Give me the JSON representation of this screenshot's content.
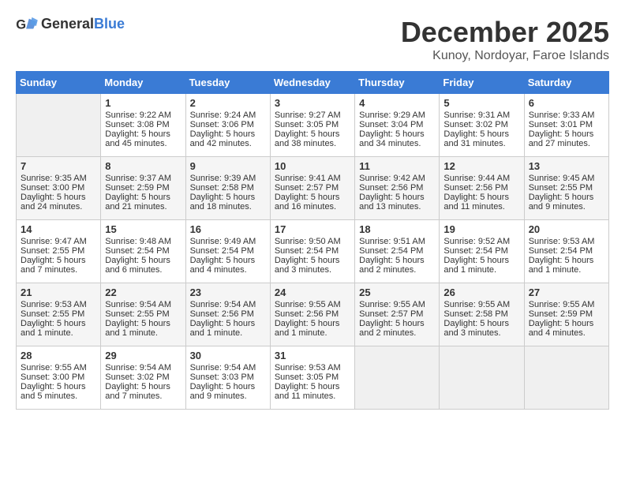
{
  "header": {
    "logo_general": "General",
    "logo_blue": "Blue",
    "month_title": "December 2025",
    "location": "Kunoy, Nordoyar, Faroe Islands"
  },
  "days_of_week": [
    "Sunday",
    "Monday",
    "Tuesday",
    "Wednesday",
    "Thursday",
    "Friday",
    "Saturday"
  ],
  "weeks": [
    [
      {
        "day": "",
        "data": ""
      },
      {
        "day": "1",
        "data": "Sunrise: 9:22 AM\nSunset: 3:08 PM\nDaylight: 5 hours\nand 45 minutes."
      },
      {
        "day": "2",
        "data": "Sunrise: 9:24 AM\nSunset: 3:06 PM\nDaylight: 5 hours\nand 42 minutes."
      },
      {
        "day": "3",
        "data": "Sunrise: 9:27 AM\nSunset: 3:05 PM\nDaylight: 5 hours\nand 38 minutes."
      },
      {
        "day": "4",
        "data": "Sunrise: 9:29 AM\nSunset: 3:04 PM\nDaylight: 5 hours\nand 34 minutes."
      },
      {
        "day": "5",
        "data": "Sunrise: 9:31 AM\nSunset: 3:02 PM\nDaylight: 5 hours\nand 31 minutes."
      },
      {
        "day": "6",
        "data": "Sunrise: 9:33 AM\nSunset: 3:01 PM\nDaylight: 5 hours\nand 27 minutes."
      }
    ],
    [
      {
        "day": "7",
        "data": "Sunrise: 9:35 AM\nSunset: 3:00 PM\nDaylight: 5 hours\nand 24 minutes."
      },
      {
        "day": "8",
        "data": "Sunrise: 9:37 AM\nSunset: 2:59 PM\nDaylight: 5 hours\nand 21 minutes."
      },
      {
        "day": "9",
        "data": "Sunrise: 9:39 AM\nSunset: 2:58 PM\nDaylight: 5 hours\nand 18 minutes."
      },
      {
        "day": "10",
        "data": "Sunrise: 9:41 AM\nSunset: 2:57 PM\nDaylight: 5 hours\nand 16 minutes."
      },
      {
        "day": "11",
        "data": "Sunrise: 9:42 AM\nSunset: 2:56 PM\nDaylight: 5 hours\nand 13 minutes."
      },
      {
        "day": "12",
        "data": "Sunrise: 9:44 AM\nSunset: 2:56 PM\nDaylight: 5 hours\nand 11 minutes."
      },
      {
        "day": "13",
        "data": "Sunrise: 9:45 AM\nSunset: 2:55 PM\nDaylight: 5 hours\nand 9 minutes."
      }
    ],
    [
      {
        "day": "14",
        "data": "Sunrise: 9:47 AM\nSunset: 2:55 PM\nDaylight: 5 hours\nand 7 minutes."
      },
      {
        "day": "15",
        "data": "Sunrise: 9:48 AM\nSunset: 2:54 PM\nDaylight: 5 hours\nand 6 minutes."
      },
      {
        "day": "16",
        "data": "Sunrise: 9:49 AM\nSunset: 2:54 PM\nDaylight: 5 hours\nand 4 minutes."
      },
      {
        "day": "17",
        "data": "Sunrise: 9:50 AM\nSunset: 2:54 PM\nDaylight: 5 hours\nand 3 minutes."
      },
      {
        "day": "18",
        "data": "Sunrise: 9:51 AM\nSunset: 2:54 PM\nDaylight: 5 hours\nand 2 minutes."
      },
      {
        "day": "19",
        "data": "Sunrise: 9:52 AM\nSunset: 2:54 PM\nDaylight: 5 hours\nand 1 minute."
      },
      {
        "day": "20",
        "data": "Sunrise: 9:53 AM\nSunset: 2:54 PM\nDaylight: 5 hours\nand 1 minute."
      }
    ],
    [
      {
        "day": "21",
        "data": "Sunrise: 9:53 AM\nSunset: 2:55 PM\nDaylight: 5 hours\nand 1 minute."
      },
      {
        "day": "22",
        "data": "Sunrise: 9:54 AM\nSunset: 2:55 PM\nDaylight: 5 hours\nand 1 minute."
      },
      {
        "day": "23",
        "data": "Sunrise: 9:54 AM\nSunset: 2:56 PM\nDaylight: 5 hours\nand 1 minute."
      },
      {
        "day": "24",
        "data": "Sunrise: 9:55 AM\nSunset: 2:56 PM\nDaylight: 5 hours\nand 1 minute."
      },
      {
        "day": "25",
        "data": "Sunrise: 9:55 AM\nSunset: 2:57 PM\nDaylight: 5 hours\nand 2 minutes."
      },
      {
        "day": "26",
        "data": "Sunrise: 9:55 AM\nSunset: 2:58 PM\nDaylight: 5 hours\nand 3 minutes."
      },
      {
        "day": "27",
        "data": "Sunrise: 9:55 AM\nSunset: 2:59 PM\nDaylight: 5 hours\nand 4 minutes."
      }
    ],
    [
      {
        "day": "28",
        "data": "Sunrise: 9:55 AM\nSunset: 3:00 PM\nDaylight: 5 hours\nand 5 minutes."
      },
      {
        "day": "29",
        "data": "Sunrise: 9:54 AM\nSunset: 3:02 PM\nDaylight: 5 hours\nand 7 minutes."
      },
      {
        "day": "30",
        "data": "Sunrise: 9:54 AM\nSunset: 3:03 PM\nDaylight: 5 hours\nand 9 minutes."
      },
      {
        "day": "31",
        "data": "Sunrise: 9:53 AM\nSunset: 3:05 PM\nDaylight: 5 hours\nand 11 minutes."
      },
      {
        "day": "",
        "data": ""
      },
      {
        "day": "",
        "data": ""
      },
      {
        "day": "",
        "data": ""
      }
    ]
  ]
}
